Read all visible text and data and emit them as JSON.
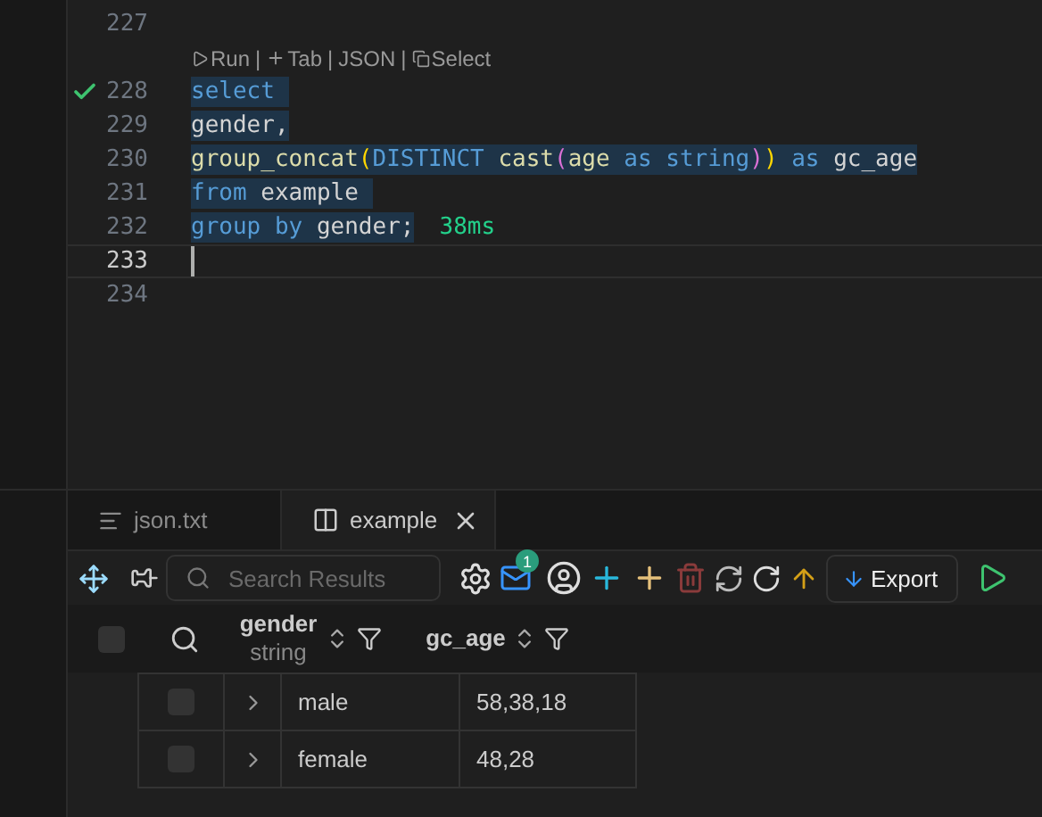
{
  "editor": {
    "lines": [
      {
        "number": "227",
        "succeeded": false,
        "current": false
      },
      {
        "kind": "codelens",
        "separator": "|",
        "items": [
          {
            "label": "Run"
          },
          {
            "label": "Tab"
          },
          {
            "label": "JSON"
          },
          {
            "label": "Select"
          }
        ]
      },
      {
        "number": "228",
        "succeeded": true,
        "selected": true,
        "current": false,
        "tokens": [
          {
            "kind": "keyword",
            "text": "select "
          }
        ]
      },
      {
        "number": "229",
        "succeeded": false,
        "selected": true,
        "current": false,
        "tokens": [
          {
            "kind": "ident",
            "text": "gender,"
          }
        ]
      },
      {
        "number": "230",
        "succeeded": false,
        "selected": true,
        "current": false,
        "tokens": [
          {
            "kind": "function",
            "text": "group_concat"
          },
          {
            "kind": "paren1",
            "text": "("
          },
          {
            "kind": "keyword",
            "text": "DISTINCT "
          },
          {
            "kind": "function",
            "text": "cast"
          },
          {
            "kind": "paren2",
            "text": "("
          },
          {
            "kind": "function",
            "text": "age "
          },
          {
            "kind": "keyword",
            "text": "as string"
          },
          {
            "kind": "paren2",
            "text": ")"
          },
          {
            "kind": "paren1",
            "text": ")"
          },
          {
            "kind": "keyword",
            "text": " as "
          },
          {
            "kind": "ident",
            "text": "gc_age"
          }
        ]
      },
      {
        "number": "231",
        "succeeded": false,
        "selected": true,
        "current": false,
        "tokens": [
          {
            "kind": "keyword",
            "text": "from "
          },
          {
            "kind": "ident",
            "text": "example "
          }
        ]
      },
      {
        "number": "232",
        "succeeded": false,
        "selected": true,
        "current": false,
        "tokens": [
          {
            "kind": "keyword",
            "text": "group by "
          },
          {
            "kind": "ident",
            "text": "gender;"
          }
        ],
        "timing": "38ms"
      },
      {
        "number": "233",
        "succeeded": false,
        "current": true
      },
      {
        "number": "234",
        "succeeded": false,
        "current": false
      }
    ]
  },
  "tabs": [
    {
      "label": "json.txt",
      "selected": false
    },
    {
      "label": "example",
      "selected": true
    }
  ],
  "toolbar": {
    "search": {
      "placeholder": "Search Results"
    },
    "notification_count": "1",
    "export_label": "Export"
  },
  "table": {
    "columns": [
      {
        "name": "gender",
        "type": "string"
      },
      {
        "name": "gc_age"
      }
    ],
    "rows": [
      {
        "checked": false,
        "cells": [
          "male",
          "58,38,18"
        ]
      },
      {
        "checked": false,
        "cells": [
          "female",
          "48,28"
        ]
      }
    ],
    "header_checked": false
  }
}
